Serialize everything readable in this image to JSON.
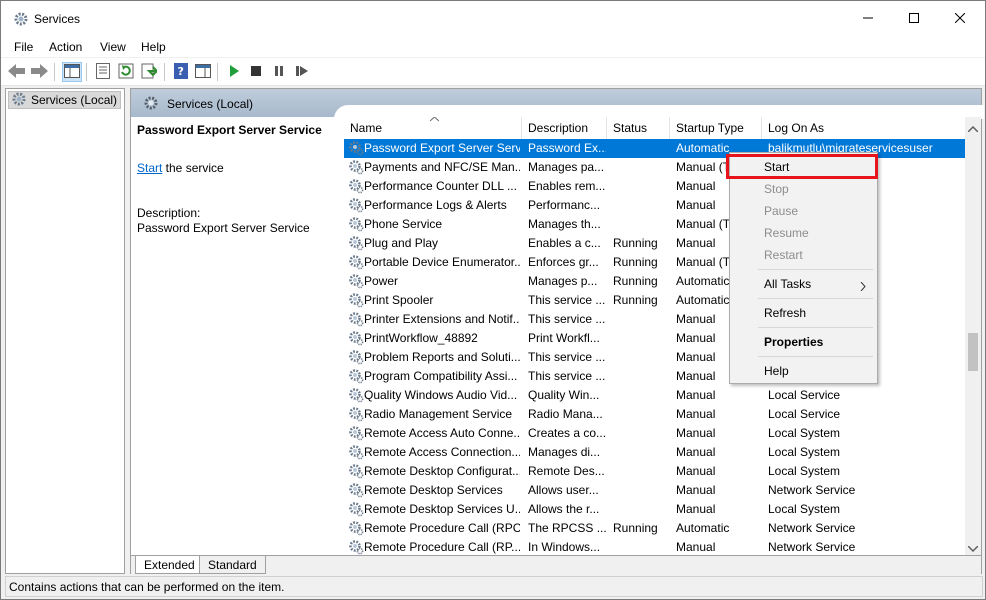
{
  "window": {
    "title": "Services"
  },
  "menu": [
    "File",
    "Action",
    "View",
    "Help"
  ],
  "tree": {
    "root": "Services (Local)"
  },
  "main": {
    "header": "Services (Local)",
    "description": {
      "service_name": "Password Export Server Service",
      "start_link": "Start",
      "start_suffix": " the service",
      "label": "Description:",
      "text": "Password Export Server Service"
    },
    "columns": [
      "Name",
      "Description",
      "Status",
      "Startup Type",
      "Log On As"
    ],
    "rows": [
      {
        "name": "Password Export Server Serv...",
        "desc": "Password Ex...",
        "status": "",
        "startup": "Automatic",
        "logon": "balikmutlu\\migrateservicesuser"
      },
      {
        "name": "Payments and NFC/SE Man...",
        "desc": "Manages pa...",
        "status": "",
        "startup": "Manual (T",
        "logon": ""
      },
      {
        "name": "Performance Counter DLL ...",
        "desc": "Enables rem...",
        "status": "",
        "startup": "Manual",
        "logon": ""
      },
      {
        "name": "Performance Logs & Alerts",
        "desc": "Performanc...",
        "status": "",
        "startup": "Manual",
        "logon": ""
      },
      {
        "name": "Phone Service",
        "desc": "Manages th...",
        "status": "",
        "startup": "Manual (T",
        "logon": ""
      },
      {
        "name": "Plug and Play",
        "desc": "Enables a c...",
        "status": "Running",
        "startup": "Manual",
        "logon": ""
      },
      {
        "name": "Portable Device Enumerator...",
        "desc": "Enforces gr...",
        "status": "Running",
        "startup": "Manual (T",
        "logon": ""
      },
      {
        "name": "Power",
        "desc": "Manages p...",
        "status": "Running",
        "startup": "Automatic",
        "logon": ""
      },
      {
        "name": "Print Spooler",
        "desc": "This service ...",
        "status": "Running",
        "startup": "Automatic",
        "logon": ""
      },
      {
        "name": "Printer Extensions and Notif...",
        "desc": "This service ...",
        "status": "",
        "startup": "Manual",
        "logon": ""
      },
      {
        "name": "PrintWorkflow_48892",
        "desc": "Print Workfl...",
        "status": "",
        "startup": "Manual",
        "logon": ""
      },
      {
        "name": "Problem Reports and Soluti...",
        "desc": "This service ...",
        "status": "",
        "startup": "Manual",
        "logon": ""
      },
      {
        "name": "Program Compatibility Assi...",
        "desc": "This service ...",
        "status": "",
        "startup": "Manual",
        "logon": ""
      },
      {
        "name": "Quality Windows Audio Vid...",
        "desc": "Quality Win...",
        "status": "",
        "startup": "Manual",
        "logon": "Local Service"
      },
      {
        "name": "Radio Management Service",
        "desc": "Radio Mana...",
        "status": "",
        "startup": "Manual",
        "logon": "Local Service"
      },
      {
        "name": "Remote Access Auto Conne...",
        "desc": "Creates a co...",
        "status": "",
        "startup": "Manual",
        "logon": "Local System"
      },
      {
        "name": "Remote Access Connection...",
        "desc": "Manages di...",
        "status": "",
        "startup": "Manual",
        "logon": "Local System"
      },
      {
        "name": "Remote Desktop Configurat...",
        "desc": "Remote Des...",
        "status": "",
        "startup": "Manual",
        "logon": "Local System"
      },
      {
        "name": "Remote Desktop Services",
        "desc": "Allows user...",
        "status": "",
        "startup": "Manual",
        "logon": "Network Service"
      },
      {
        "name": "Remote Desktop Services U...",
        "desc": "Allows the r...",
        "status": "",
        "startup": "Manual",
        "logon": "Local System"
      },
      {
        "name": "Remote Procedure Call (RPC)",
        "desc": "The RPCSS ...",
        "status": "Running",
        "startup": "Automatic",
        "logon": "Network Service"
      },
      {
        "name": "Remote Procedure Call (RP...",
        "desc": "In Windows...",
        "status": "",
        "startup": "Manual",
        "logon": "Network Service"
      }
    ]
  },
  "tabs": [
    "Extended",
    "Standard"
  ],
  "context_menu": {
    "start": "Start",
    "stop": "Stop",
    "pause": "Pause",
    "resume": "Resume",
    "restart": "Restart",
    "all_tasks": "All Tasks",
    "refresh": "Refresh",
    "properties": "Properties",
    "help": "Help"
  },
  "status_bar": "Contains actions that can be performed on the item.",
  "colors": {
    "selection": "#0078d7",
    "highlight_box": "#e8141c",
    "link": "#0066cc"
  }
}
